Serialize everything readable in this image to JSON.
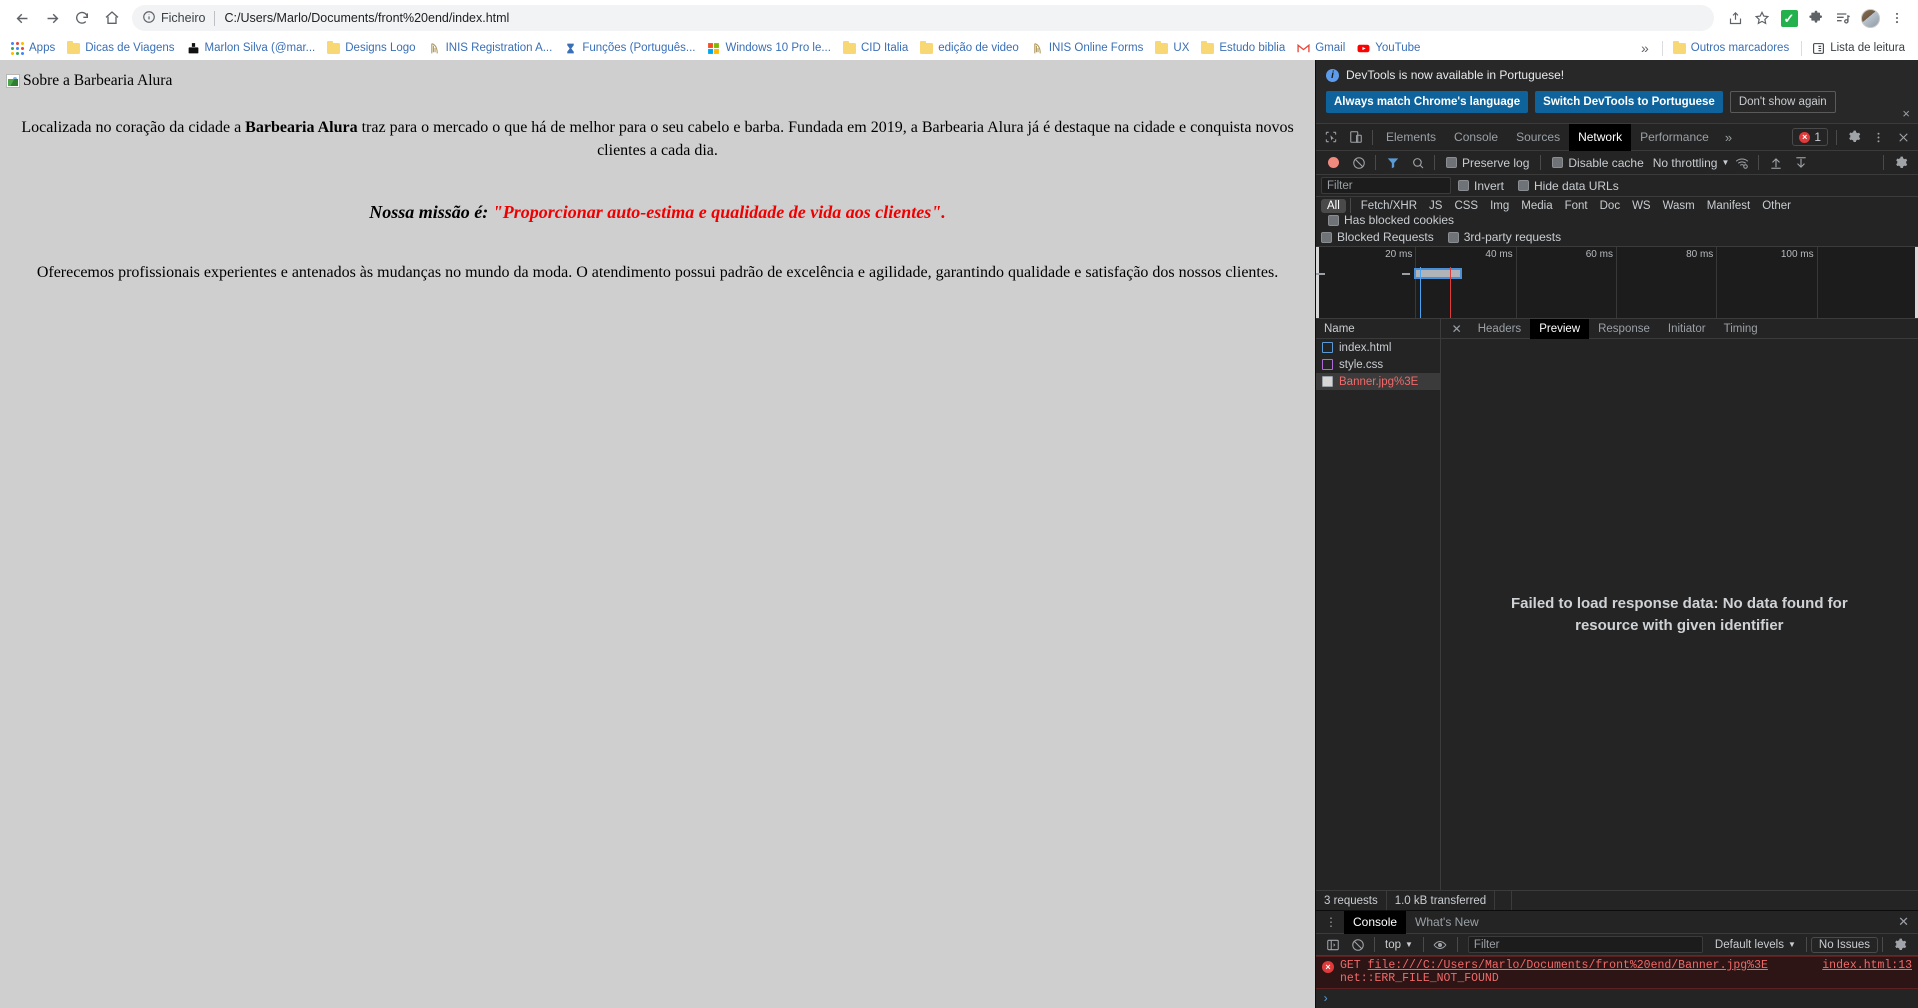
{
  "browser": {
    "nav": {
      "back_label": "Back",
      "forward_label": "Forward",
      "reload_label": "Reload",
      "home_label": "Home"
    },
    "omnibox": {
      "site_info_label": "Ficheiro",
      "url": "C:/Users/Marlo/Documents/front%20end/index.html"
    },
    "toolbar_icons": [
      "share-icon",
      "bookmark-star-icon",
      "extension-green-check-icon",
      "puzzle-extension-icon",
      "media-playlist-icon",
      "profile-avatar",
      "chrome-menu-icon"
    ],
    "bookmarks": {
      "apps_label": "Apps",
      "items": [
        {
          "label": "Dicas de Viagens",
          "icon": "folder-icon"
        },
        {
          "label": "Marlon Silva (@mar...",
          "icon": "site-favicon"
        },
        {
          "label": "Designs Logo",
          "icon": "folder-icon"
        },
        {
          "label": "INIS Registration A...",
          "icon": "harp-favicon"
        },
        {
          "label": "Funções (Português...",
          "icon": "hourglass-favicon"
        },
        {
          "label": "Windows 10 Pro le...",
          "icon": "windows-favicon"
        },
        {
          "label": "CID Italia",
          "icon": "folder-icon"
        },
        {
          "label": "edição de video",
          "icon": "folder-icon"
        },
        {
          "label": "INIS Online Forms",
          "icon": "harp-favicon"
        },
        {
          "label": "UX",
          "icon": "folder-icon"
        },
        {
          "label": "Estudo biblia",
          "icon": "folder-icon"
        },
        {
          "label": "Gmail",
          "icon": "gmail-favicon"
        },
        {
          "label": "YouTube",
          "icon": "youtube-favicon"
        }
      ],
      "overflow_label": "»",
      "other_bookmarks_label": "Outros marcadores",
      "reading_list_label": "Lista de leitura"
    }
  },
  "page": {
    "broken_image_alt": "Sobre a Barbearia Alura",
    "intro_before": "Localizada no coração da cidade a ",
    "intro_bold": "Barbearia Alura",
    "intro_after": " traz para o mercado o que há de melhor para o seu cabelo e barba. Fundada em 2019, a Barbearia Alura já é destaque na cidade e conquista novos clientes a cada dia.",
    "mission_prefix": "Nossa missão é: ",
    "mission_quote": "\"Proporcionar auto-estima e qualidade de vida aos clientes\".",
    "closing": "Oferecemos profissionais experientes e antenados às mudanças no mundo da moda. O atendimento possui padrão de excelência e agilidade, garantindo qualidade e satisfação dos nossos clientes.",
    "background_color": "#cfcfcf",
    "mission_color": "#ef0000"
  },
  "devtools": {
    "notice": {
      "text": "DevTools is now available in Portuguese!",
      "primary_button": "Always match Chrome's language",
      "secondary_button": "Switch DevTools to Portuguese",
      "dismiss_button": "Don't show again",
      "close_label": "×"
    },
    "tabs": [
      "Elements",
      "Console",
      "Sources",
      "Network",
      "Performance"
    ],
    "active_tab": "Network",
    "tabs_overflow": "»",
    "error_count": "1",
    "network_toolbar": {
      "preserve_log": "Preserve log",
      "disable_cache": "Disable cache",
      "throttling": "No throttling",
      "filter_placeholder": "Filter",
      "invert": "Invert",
      "hide_data_urls": "Hide data URLs"
    },
    "type_filters": [
      "All",
      "Fetch/XHR",
      "JS",
      "CSS",
      "Img",
      "Media",
      "Font",
      "Doc",
      "WS",
      "Wasm",
      "Manifest",
      "Other"
    ],
    "active_type_filter": "All",
    "has_blocked_cookies": "Has blocked cookies",
    "blocked_requests": "Blocked Requests",
    "third_party_requests": "3rd-party requests",
    "overview_ticks": [
      "20 ms",
      "40 ms",
      "60 ms",
      "80 ms",
      "100 ms"
    ],
    "request_list": {
      "header": "Name",
      "rows": [
        {
          "name": "index.html",
          "kind": "html",
          "state": "normal"
        },
        {
          "name": "style.css",
          "kind": "css",
          "state": "normal"
        },
        {
          "name": "Banner.jpg%3E",
          "kind": "img",
          "state": "error"
        }
      ],
      "selected_index": 2
    },
    "detail_tabs": [
      "Headers",
      "Preview",
      "Response",
      "Initiator",
      "Timing"
    ],
    "active_detail_tab": "Preview",
    "detail_message": "Failed to load response data: No data found for resource with given identifier",
    "status_bar": {
      "requests": "3 requests",
      "transferred": "1.0 kB transferred"
    },
    "drawer": {
      "tabs": [
        "Console",
        "What's New"
      ],
      "active_tab": "Console",
      "toolbar": {
        "context": "top",
        "filter_placeholder": "Filter",
        "levels": "Default levels",
        "issues": "No Issues"
      },
      "error": {
        "method": "GET",
        "url": "file:///C:/Users/Marlo/Documents/front%20end/Banner.jpg%3E",
        "detail": "net::ERR_FILE_NOT_FOUND",
        "source": "index.html:13"
      },
      "prompt_symbol": "›"
    }
  }
}
